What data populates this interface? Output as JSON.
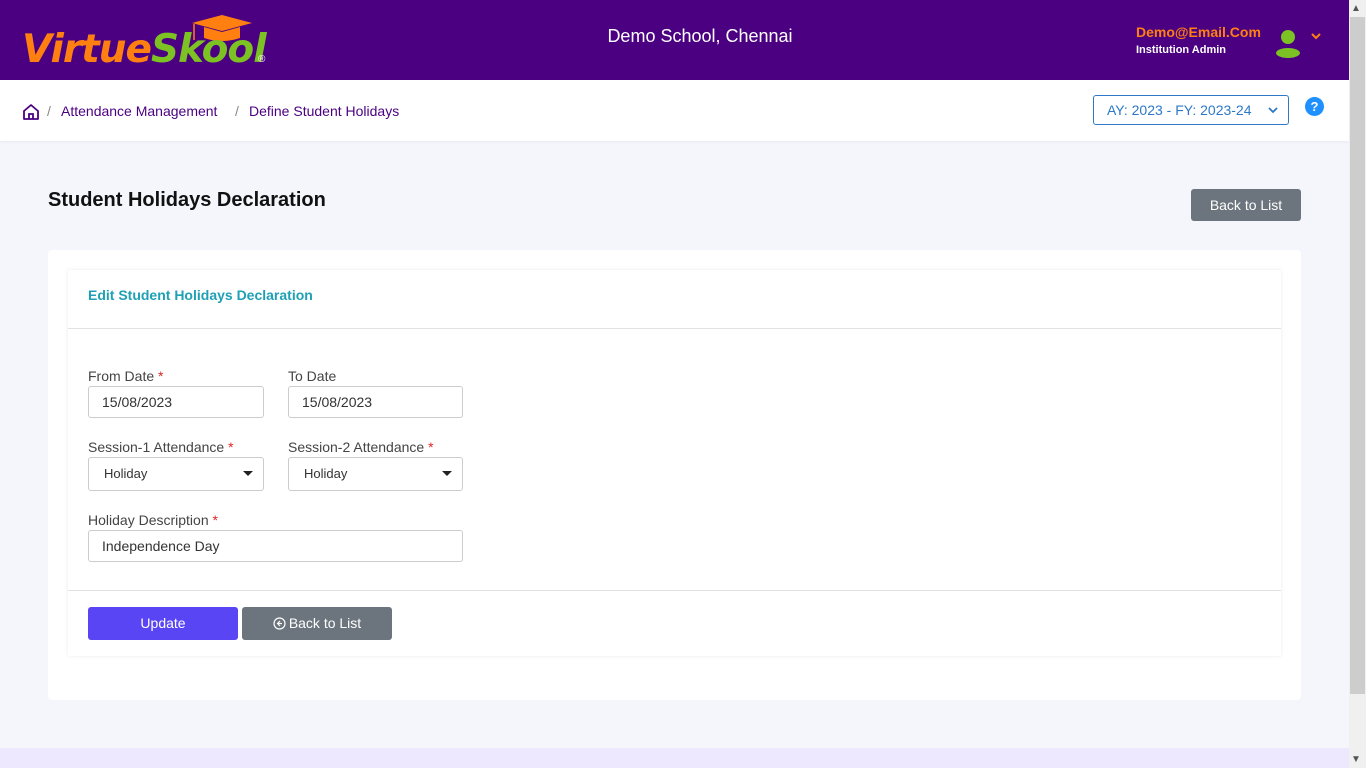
{
  "header": {
    "logo": {
      "part1": "Virtue",
      "part2": "Skool",
      "registered": "®"
    },
    "school_name": "Demo School, Chennai",
    "user": {
      "email": "Demo@Email.Com",
      "role": "Institution Admin",
      "avatar_icon": "user-icon",
      "menu_icon": "chevron-down-icon"
    }
  },
  "breadcrumb": {
    "home_icon": "home-icon",
    "separator": "/",
    "items": [
      "Attendance Management",
      "Define Student Holidays"
    ]
  },
  "year_selector": {
    "value": "AY: 2023 - FY: 2023-24"
  },
  "help": {
    "label": "?"
  },
  "page": {
    "title": "Student Holidays Declaration",
    "back_button": "Back to List"
  },
  "form": {
    "title": "Edit Student Holidays Declaration",
    "required_marker": "*",
    "from_date": {
      "label": "From Date",
      "value": "15/08/2023"
    },
    "to_date": {
      "label": "To Date",
      "value": "15/08/2023"
    },
    "session1": {
      "label": "Session-1 Attendance",
      "value": "Holiday"
    },
    "session2": {
      "label": "Session-2 Attendance",
      "value": "Holiday"
    },
    "description": {
      "label": "Holiday Description",
      "value": "Independence Day"
    },
    "update_button": "Update",
    "back_button": "Back to List"
  },
  "colors": {
    "brand": "#4b0082",
    "accent_orange": "#ff7f11",
    "accent_green": "#7cc223",
    "primary_button": "#5a45f5",
    "secondary_button": "#6c757d",
    "card_title": "#1fa0b5"
  }
}
